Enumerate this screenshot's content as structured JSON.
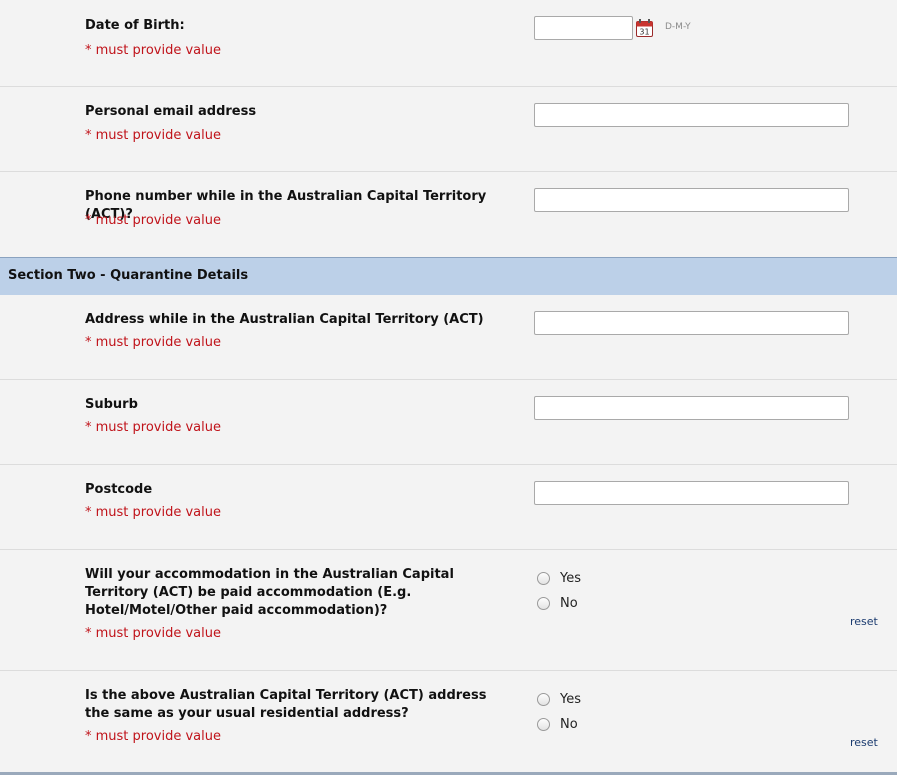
{
  "required_text": "* must provide value",
  "section_one_fields": {
    "dob": {
      "label": "Date of Birth:",
      "value": "",
      "format_hint": "D-M-Y",
      "calendar_day": "31"
    },
    "email": {
      "label": "Personal email address",
      "value": ""
    },
    "phone": {
      "label": "Phone number while in the Australian Capital Territory (ACT)?",
      "value": ""
    }
  },
  "section_two": {
    "title": "Section Two - Quarantine Details",
    "address": {
      "label": "Address while in the Australian Capital Territory (ACT)",
      "value": ""
    },
    "suburb": {
      "label": "Suburb",
      "value": ""
    },
    "postcode": {
      "label": "Postcode",
      "value": ""
    },
    "paid_accommodation": {
      "label": "Will your accommodation in the Australian Capital Territory (ACT) be paid accommodation (E.g. Hotel/Motel/Other paid accommodation)?",
      "options": [
        "Yes",
        "No"
      ],
      "selected": null,
      "reset_label": "reset"
    },
    "same_address": {
      "label": "Is the above Australian Capital Territory (ACT) address the same as your usual residential address?",
      "options": [
        "Yes",
        "No"
      ],
      "selected": null,
      "reset_label": "reset"
    }
  },
  "colors": {
    "required": "#c0131a",
    "section_header_bg": "#bcd0e8",
    "page_bg": "#f3f3f3",
    "link": "#1b3b6f"
  }
}
